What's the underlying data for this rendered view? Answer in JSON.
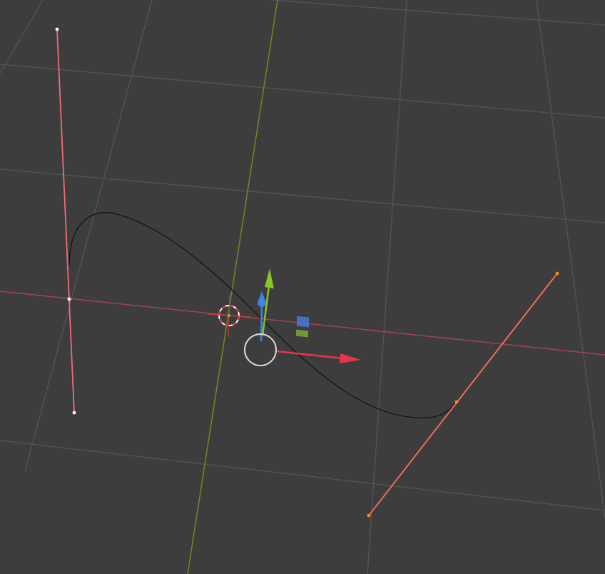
{
  "viewport": {
    "background": "#3d3d3d",
    "grid_color": "#545454",
    "x_axis_color": "#a3424f",
    "y_axis_color": "#6b8c1f"
  },
  "curve": {
    "color": "#141414",
    "handle_selected_color": "#f06b78",
    "handle_vertex_color": "#ffffff",
    "active_handle_color": "#ff6f5c",
    "active_vertex_color": "#ff8a1a"
  },
  "gizmo": {
    "x_arrow_color": "#e8354b",
    "y_arrow_color": "#86c52a",
    "z_arrow_color": "#3d86e0",
    "plane_xz_color": "#4a79d8",
    "plane_xy_color": "#7aa83a",
    "view_circle_color": "#d9d9d9"
  },
  "cursor_3d": {
    "ring_red": "#d03c3c",
    "ring_white": "#ffffff",
    "center_color": "#e89a4b"
  }
}
